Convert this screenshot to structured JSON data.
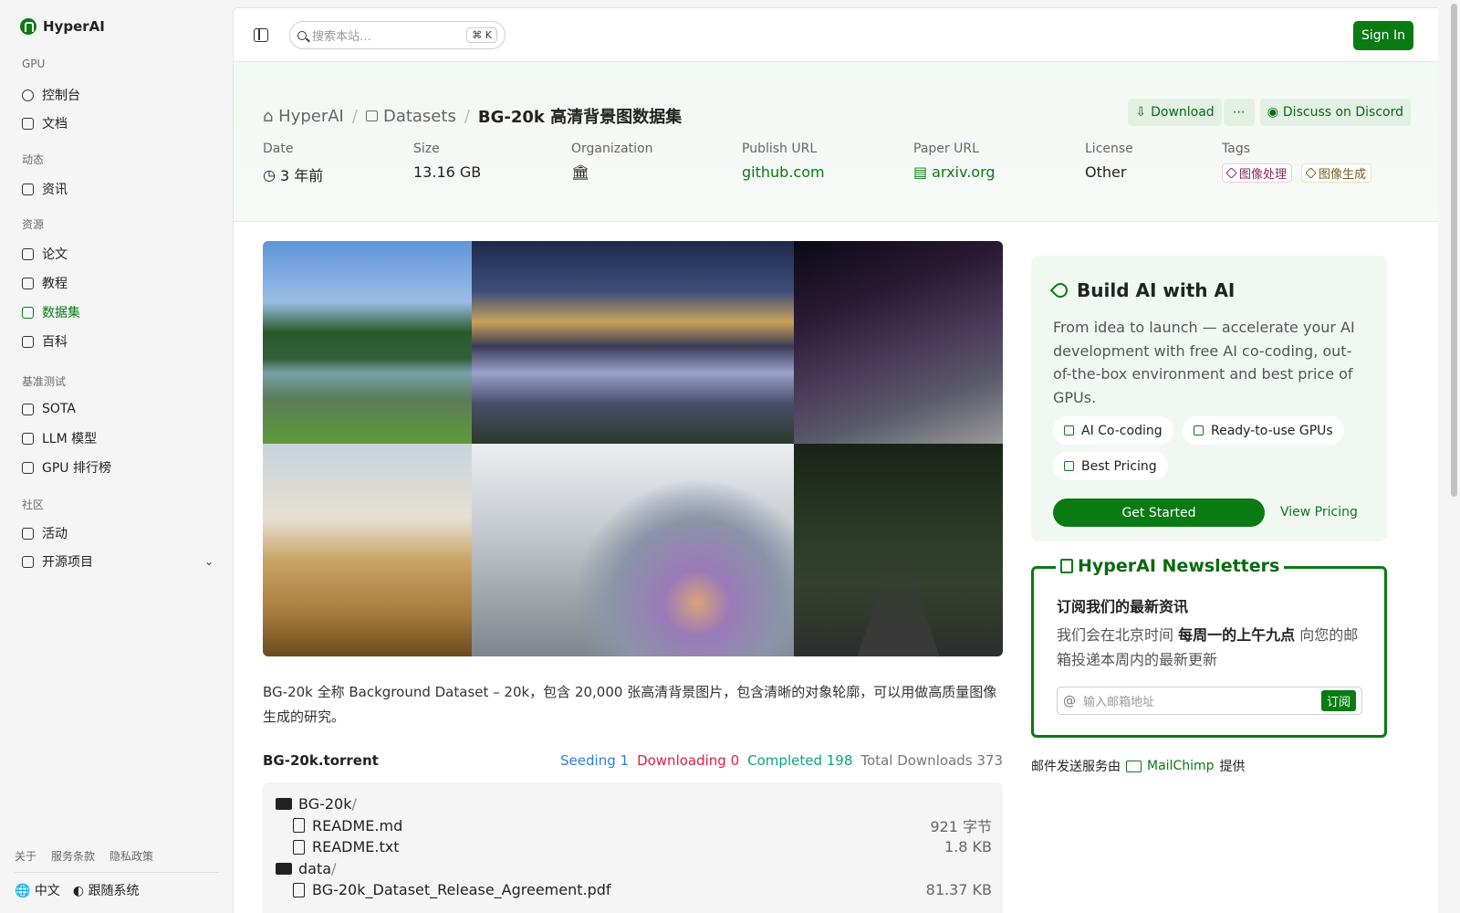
{
  "sidebar": {
    "brand": "HyperAI",
    "sections": [
      {
        "label": "GPU",
        "items": [
          {
            "label": "控制台"
          },
          {
            "label": "文档"
          }
        ]
      },
      {
        "label": "动态",
        "items": [
          {
            "label": "资讯"
          }
        ]
      },
      {
        "label": "资源",
        "items": [
          {
            "label": "论文"
          },
          {
            "label": "教程"
          },
          {
            "label": "数据集"
          },
          {
            "label": "百科"
          }
        ]
      },
      {
        "label": "基准测试",
        "items": [
          {
            "label": "SOTA"
          },
          {
            "label": "LLM 模型"
          },
          {
            "label": "GPU 排行榜"
          }
        ]
      },
      {
        "label": "社区",
        "items": [
          {
            "label": "活动"
          },
          {
            "label": "开源项目"
          }
        ]
      }
    ],
    "footer_links": [
      "关于",
      "服务条款",
      "隐私政策"
    ],
    "language": "中文",
    "theme": "跟随系统"
  },
  "topbar": {
    "search_placeholder": "搜索本站…",
    "shortcut": "K",
    "sign_in": "Sign In"
  },
  "header": {
    "breadcrumb": [
      "HyperAI",
      "Datasets"
    ],
    "title_bold": "BG-20k",
    "title_rest": "高清背景图数据集",
    "buttons": {
      "download": "Download",
      "discord": "Discuss on Discord"
    },
    "meta": {
      "date": {
        "label": "Date",
        "value": "3 年前"
      },
      "size": {
        "label": "Size",
        "value": "13.16 GB"
      },
      "organization": {
        "label": "Organization"
      },
      "publish_url": {
        "label": "Publish URL",
        "value": "github.com"
      },
      "paper_url": {
        "label": "Paper URL",
        "value": "arxiv.org"
      },
      "license": {
        "label": "License",
        "value": "Other"
      },
      "tags": {
        "label": "Tags",
        "values": [
          "图像处理",
          "图像生成"
        ]
      }
    }
  },
  "description": "BG-20k 全称 Background Dataset – 20k，包含 20,000 张高清背景图片，包含清晰的对象轮廓，可以用做高质量图像生成的研究。",
  "torrent": {
    "name": "BG-20k.torrent",
    "seeding_label": "Seeding",
    "seeding": "1",
    "downloading_label": "Downloading",
    "downloading": "0",
    "completed_label": "Completed",
    "completed": "198",
    "total_label": "Total Downloads",
    "total": "373",
    "files": [
      {
        "name": "BG-20k",
        "type": "folder"
      },
      {
        "name": "README.md",
        "size": "921 字节",
        "type": "file"
      },
      {
        "name": "README.txt",
        "size": "1.8 KB",
        "type": "file"
      },
      {
        "name": "data",
        "type": "folder"
      },
      {
        "name": "BG-20k_Dataset_Release_Agreement.pdf",
        "size": "81.37 KB",
        "type": "file"
      }
    ]
  },
  "promo": {
    "title": "Build AI with AI",
    "description": "From idea to launch — accelerate your AI development with free AI co-coding, out-of-the-box environment and best price of GPUs.",
    "chips": [
      "AI Co-coding",
      "Ready-to-use GPUs",
      "Best Pricing"
    ],
    "cta": "Get Started",
    "link": "View Pricing"
  },
  "newsletter": {
    "title": "HyperAI Newsletters",
    "heading": "订阅我们的最新资讯",
    "text_before": "我们会在北京时间 ",
    "text_bold": "每周一的上午九点",
    "text_after": " 向您的邮箱投递本周内的最新更新",
    "email_placeholder": "输入邮箱地址",
    "subscribe": "订阅",
    "provider_before": "邮件发送服务由",
    "provider": "MailChimp",
    "provider_after": "提供"
  },
  "colors": {
    "accent": "#0a7a12",
    "seeding": "#2f7de1",
    "downloading": "#e11d48",
    "completed": "#10a37f"
  }
}
